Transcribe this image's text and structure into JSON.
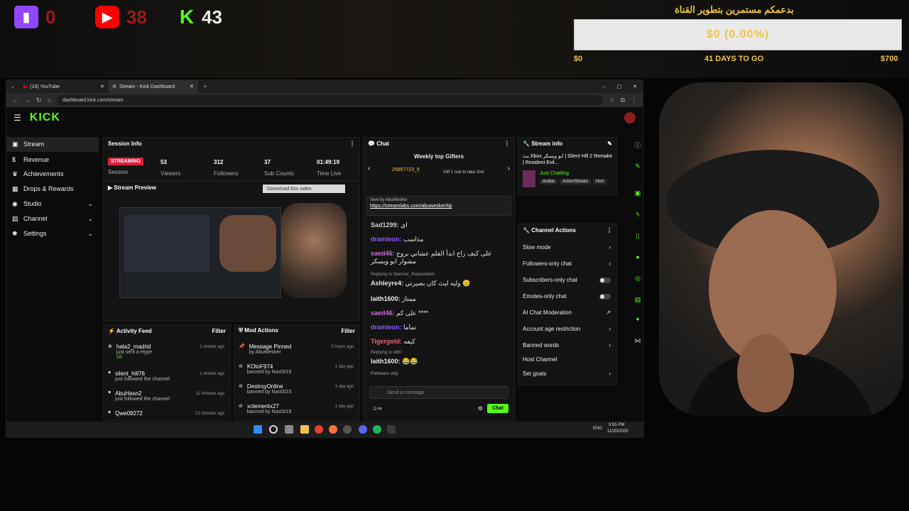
{
  "overlay": {
    "twitch_count": "0",
    "youtube_count": "38",
    "kick_count": "43",
    "goal_title": "بدعمكم مستمرين بتطوير القناة",
    "goal_progress": "$0 (0.00%)",
    "goal_current": "$0",
    "goal_days": "41 DAYS TO GO",
    "goal_target": "$700",
    "colors": {
      "goal": "#f0c54a",
      "kick": "#53fc18",
      "youtube": "#ff0000",
      "twitch": "#9146ff"
    }
  },
  "browser": {
    "tabs": [
      {
        "label": "(16) YouTube"
      },
      {
        "label": "Stream - Kick Dashboard"
      }
    ],
    "url": "dashboard.kick.com/stream"
  },
  "kick": {
    "logo": "KICK",
    "sidebar": [
      {
        "label": "Stream",
        "icon": "video-icon"
      },
      {
        "label": "Revenue",
        "icon": "dollar-icon"
      },
      {
        "label": "Achievements",
        "icon": "trophy-icon"
      },
      {
        "label": "Drops & Rewards",
        "icon": "gift-icon"
      },
      {
        "label": "Studio",
        "icon": "studio-icon"
      },
      {
        "label": "Channel",
        "icon": "channel-icon"
      },
      {
        "label": "Settings",
        "icon": "gear-icon"
      }
    ],
    "session": {
      "title": "Session Info",
      "status": "STREAMING",
      "status_label": "Session",
      "viewers": "53",
      "viewers_label": "Viewers",
      "followers": "312",
      "followers_label": "Followers",
      "subs": "37",
      "subs_label": "Sub Counts",
      "time": "01:49:19",
      "time_label": "Time Live"
    },
    "preview": {
      "title": "Stream Preview",
      "download": "Download this video"
    },
    "activity": {
      "title": "Activity Feed",
      "filter": "Filter",
      "items": [
        {
          "name": "hala2_madrid",
          "text": "just sent a Hype",
          "time": "1 minute ago",
          "extra": "10"
        },
        {
          "name": "silent_hill76",
          "text": "just followed the channel",
          "time": "1 minute ago"
        },
        {
          "name": "AbuHasn2",
          "text": "just followed the channel",
          "time": "11 minutes ago"
        },
        {
          "name": "Qwe09272",
          "text": "",
          "time": "12 minutes ago"
        }
      ]
    },
    "mod": {
      "title": "Mod Actions",
      "filter": "Filter",
      "items": [
        {
          "name": "Message Pinned",
          "by": "by AbuWesker",
          "time": "2 hours ago"
        },
        {
          "name": "KOtoF974",
          "by": "banned by Nas0015",
          "time": "1 day ago"
        },
        {
          "name": "DestroyOnline",
          "by": "banned by Nas0015",
          "time": "1 day ago"
        },
        {
          "name": "xclementx27",
          "by": "banned by Nas0015",
          "time": "1 day ago"
        }
      ]
    },
    "chat": {
      "title": "Chat",
      "gifters_title": "Weekly top Gifters",
      "gifter": "25857723_6",
      "gift_note": "Gift 1 sub to take 2nd",
      "pinned_by": "Sent by AbuWesker",
      "pinned_link": "https://streamlabs.com/abuwesker/tip",
      "messages": [
        {
          "user": "Sad1299:",
          "text": "اي",
          "color": "#cfcfcf"
        },
        {
          "user": "dramleon:",
          "text": "مذاسب",
          "color": "#8a5cff"
        },
        {
          "user": "saed46:",
          "text": "على كيف راح ابدأ الفلم عشاني بروح مشوار ابو ويسكر",
          "color": "#c86dd7"
        },
        {
          "user": "Ashleyre4:",
          "text": "وليه ليث كان بصيرتي 😊",
          "color": "#ffffff"
        },
        {
          "user": "laith1600:",
          "text": "ممتاز",
          "color": "#ffffff"
        },
        {
          "user": "saed46:",
          "text": "على كم ****",
          "color": "#c86dd7"
        },
        {
          "user": "dramleon:",
          "text": "تماما",
          "color": "#8a5cff"
        },
        {
          "user": "Tigergold:",
          "text": "كيفه",
          "color": "#e8667a"
        },
        {
          "user": "laith1600:",
          "text": "😂😂",
          "color": "#ffffff"
        }
      ],
      "reply1": "Replying to Spencer_Rawashdeh:",
      "reply2": "Replying to s6th:",
      "followers_only": "Followers only",
      "placeholder": "Send a message",
      "send": "Chat"
    },
    "stream_info": {
      "title": "Stream info",
      "stream_title": "بث Xbox ابو ويسكر | Silent Hill 2 Remake | Resident Evil...",
      "category": "Just Chatting",
      "tags": [
        "Arabic",
        "ActionStream",
        "Horr"
      ]
    },
    "channel_actions": {
      "title": "Channel Actions",
      "items": [
        {
          "label": "Slow mode",
          "kind": "arrow"
        },
        {
          "label": "Followers-only chat",
          "kind": "arrow"
        },
        {
          "label": "Subscribers-only chat",
          "kind": "toggle"
        },
        {
          "label": "Emotes-only chat",
          "kind": "toggle"
        },
        {
          "label": "AI Chat Moderation",
          "kind": "ext"
        },
        {
          "label": "Account age restriction",
          "kind": "arrow"
        },
        {
          "label": "Banned words",
          "kind": "arrow"
        },
        {
          "label": "Host Channel",
          "kind": "none"
        },
        {
          "label": "Set goals",
          "kind": "arrow"
        }
      ]
    }
  },
  "taskbar": {
    "lang": "ENG",
    "time": "9:55 PM",
    "date": "11/20/2025"
  }
}
